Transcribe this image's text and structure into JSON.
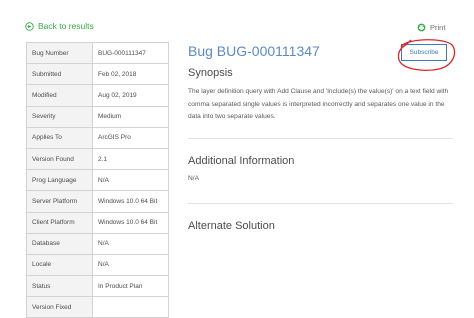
{
  "nav": {
    "back_label": "Back to results",
    "print_label": "Print"
  },
  "bug": {
    "title": "Bug BUG-000111347",
    "subscribe_label": "Subscribe"
  },
  "details": [
    {
      "key": "Bug Number",
      "value": "BUG-000111347"
    },
    {
      "key": "Submitted",
      "value": "Feb 02, 2018"
    },
    {
      "key": "Modified",
      "value": "Aug 02, 2019"
    },
    {
      "key": "Severity",
      "value": "Medium"
    },
    {
      "key": "Applies To",
      "value": "ArcGIS Pro"
    },
    {
      "key": "Version Found",
      "value": "2.1"
    },
    {
      "key": "Prog Language",
      "value": "N/A"
    },
    {
      "key": "Server Platform",
      "value": "Windows 10.0 64 Bit"
    },
    {
      "key": "Client Platform",
      "value": "Windows 10.0 64 Bit"
    },
    {
      "key": "Database",
      "value": "N/A"
    },
    {
      "key": "Locale",
      "value": "N/A"
    },
    {
      "key": "Status",
      "value": "In Product Plan"
    },
    {
      "key": "Version Fixed",
      "value": ""
    }
  ],
  "sections": {
    "synopsis_heading": "Synopsis",
    "synopsis_text": "The layer definition query with Add Clause and 'Include(s) the value(s)' on a text field with comma separated single values is interpreted incorrectly and separates one value in the data into two separate values.",
    "additional_heading": "Additional Information",
    "additional_text": "N/A",
    "alternate_heading": "Alternate Solution"
  },
  "colors": {
    "back_link": "#35ac46",
    "title": "#5b8ac5",
    "subscribe_border": "#3b7bbf",
    "annotation_circle": "#d62828"
  },
  "icons": {
    "back": "circle-arrow-left-icon",
    "print": "printer-icon"
  }
}
